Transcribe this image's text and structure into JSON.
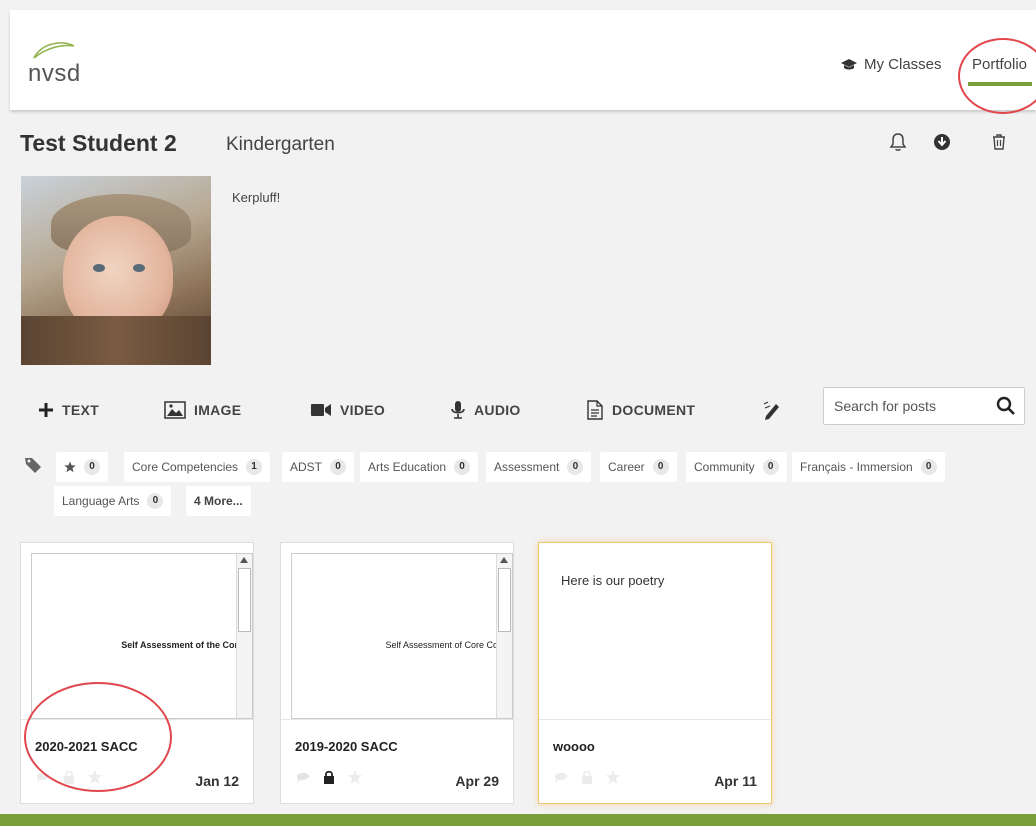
{
  "header": {
    "logo_text": "nvsd",
    "nav_classes": "My Classes",
    "nav_portfolio": "Portfolio",
    "accent": "#7a9f3a"
  },
  "student": {
    "name": "Test Student 2",
    "grade": "Kindergarten",
    "bio": "Kerpluff!"
  },
  "toolbar": {
    "text": "TEXT",
    "image": "IMAGE",
    "video": "VIDEO",
    "audio": "AUDIO",
    "document": "DOCUMENT",
    "search_placeholder": "Search for posts"
  },
  "tags": [
    {
      "label": "",
      "count": "0",
      "icon": "star-icon"
    },
    {
      "label": "Core Competencies",
      "count": "1"
    },
    {
      "label": "ADST",
      "count": "0"
    },
    {
      "label": "Arts Education",
      "count": "0"
    },
    {
      "label": "Assessment",
      "count": "0"
    },
    {
      "label": "Career",
      "count": "0"
    },
    {
      "label": "Community",
      "count": "0"
    },
    {
      "label": "Français - Immersion",
      "count": "0"
    },
    {
      "label": "Language Arts",
      "count": "0"
    }
  ],
  "tags_more": "4 More...",
  "posts": [
    {
      "preview": "Self Assessment of the Cor",
      "title": "2020-2021 SACC",
      "date": "Jan 12"
    },
    {
      "preview": "Self Assessment of Core Co",
      "title": "2019-2020 SACC",
      "date": "Apr 29"
    },
    {
      "preview": "Here is our poetry",
      "title": "woooo",
      "date": "Apr 11"
    }
  ],
  "colors": {
    "annotation": "#e0464b",
    "highlight": "#f0c673"
  }
}
